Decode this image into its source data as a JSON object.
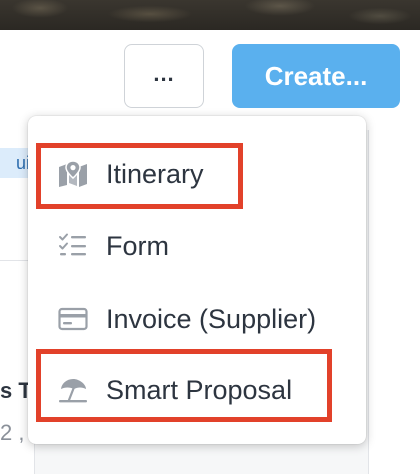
{
  "toolbar": {
    "more_label": "...",
    "create_label": "Create..."
  },
  "background": {
    "chip_partial": "ui",
    "title_partial": "s T",
    "date_partial": ", 2"
  },
  "menu": {
    "items": [
      {
        "label": "Itinerary",
        "icon": "map-pin-icon"
      },
      {
        "label": "Form",
        "icon": "checklist-icon"
      },
      {
        "label": "Invoice (Supplier)",
        "icon": "credit-card-icon"
      },
      {
        "label": "Smart Proposal",
        "icon": "beach-umbrella-icon"
      }
    ]
  },
  "colors": {
    "accent": "#5ab0ee",
    "highlight": "#e2412a",
    "icon": "#9aa0a8",
    "text": "#2d3540"
  }
}
